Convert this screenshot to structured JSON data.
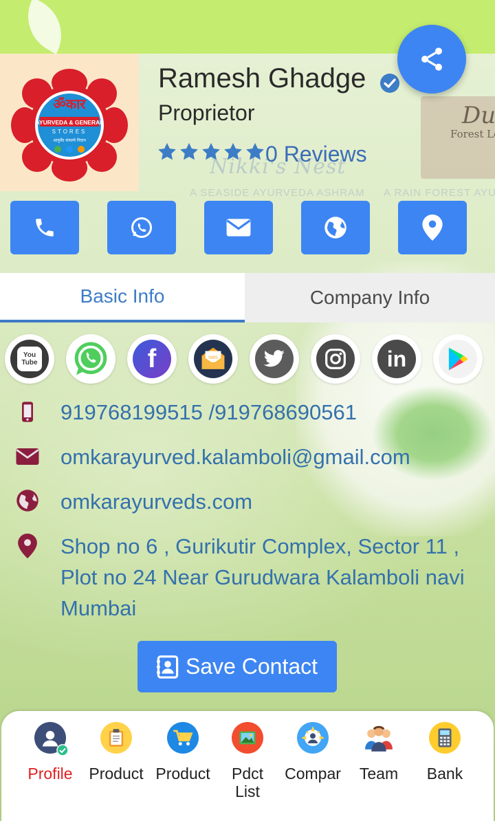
{
  "profile": {
    "name": "Ramesh Ghadge",
    "role": "Proprietor",
    "reviews": "0 Reviews",
    "rating_stars": 5,
    "logo": {
      "line1": "ॐकार",
      "line2": "AYURVEDA & GENERAL",
      "line3": "STORES",
      "line4": "आयुर्वेद संकल्पे निदान"
    }
  },
  "background": {
    "brand": "Nikki's Nest",
    "tagline_left": "A SEASIDE AYURVEDA ASHRAM",
    "tagline_right": "A RAIN FOREST AYU",
    "sign_title": "Du",
    "sign_sub": "Forest Lo"
  },
  "actions": [
    {
      "icon": "phone-icon"
    },
    {
      "icon": "whatsapp-icon"
    },
    {
      "icon": "envelope-icon"
    },
    {
      "icon": "globe-icon"
    },
    {
      "icon": "map-marker-icon"
    }
  ],
  "tabs": {
    "basic": "Basic Info",
    "company": "Company Info",
    "active": "basic"
  },
  "social": [
    {
      "name": "youtube",
      "icon": "youtube-icon",
      "label": "You Tube"
    },
    {
      "name": "whatsapp",
      "icon": "whatsapp-icon"
    },
    {
      "name": "facebook",
      "icon": "facebook-icon",
      "label": "f"
    },
    {
      "name": "sms",
      "icon": "sms-icon",
      "label": "SMS"
    },
    {
      "name": "twitter",
      "icon": "twitter-icon"
    },
    {
      "name": "instagram",
      "icon": "instagram-icon"
    },
    {
      "name": "linkedin",
      "icon": "linkedin-icon",
      "label": "in"
    },
    {
      "name": "playstore",
      "icon": "play-store-icon"
    }
  ],
  "contact": {
    "phone": "919768199515 /919768690561",
    "email": "omkarayurved.kalamboli@gmail.com",
    "website": "omkarayurveds.com",
    "address": "Shop no 6 , Gurikutir Complex, Sector 11 , Plot no 24 Near Gurudwara Kalamboli navi Mumbai"
  },
  "save_contact": "Save Contact",
  "nav": [
    {
      "label": "Profile",
      "active": true
    },
    {
      "label": "Product"
    },
    {
      "label": "Product"
    },
    {
      "label": "Pdct List"
    },
    {
      "label": "Compar"
    },
    {
      "label": "Team"
    },
    {
      "label": "Bank"
    }
  ],
  "colors": {
    "accent": "#3d85f2",
    "link": "#3471ac",
    "icon_maroon": "#8b1e3f",
    "active_nav": "#e02020",
    "top_bar": "#c4ec6e"
  }
}
